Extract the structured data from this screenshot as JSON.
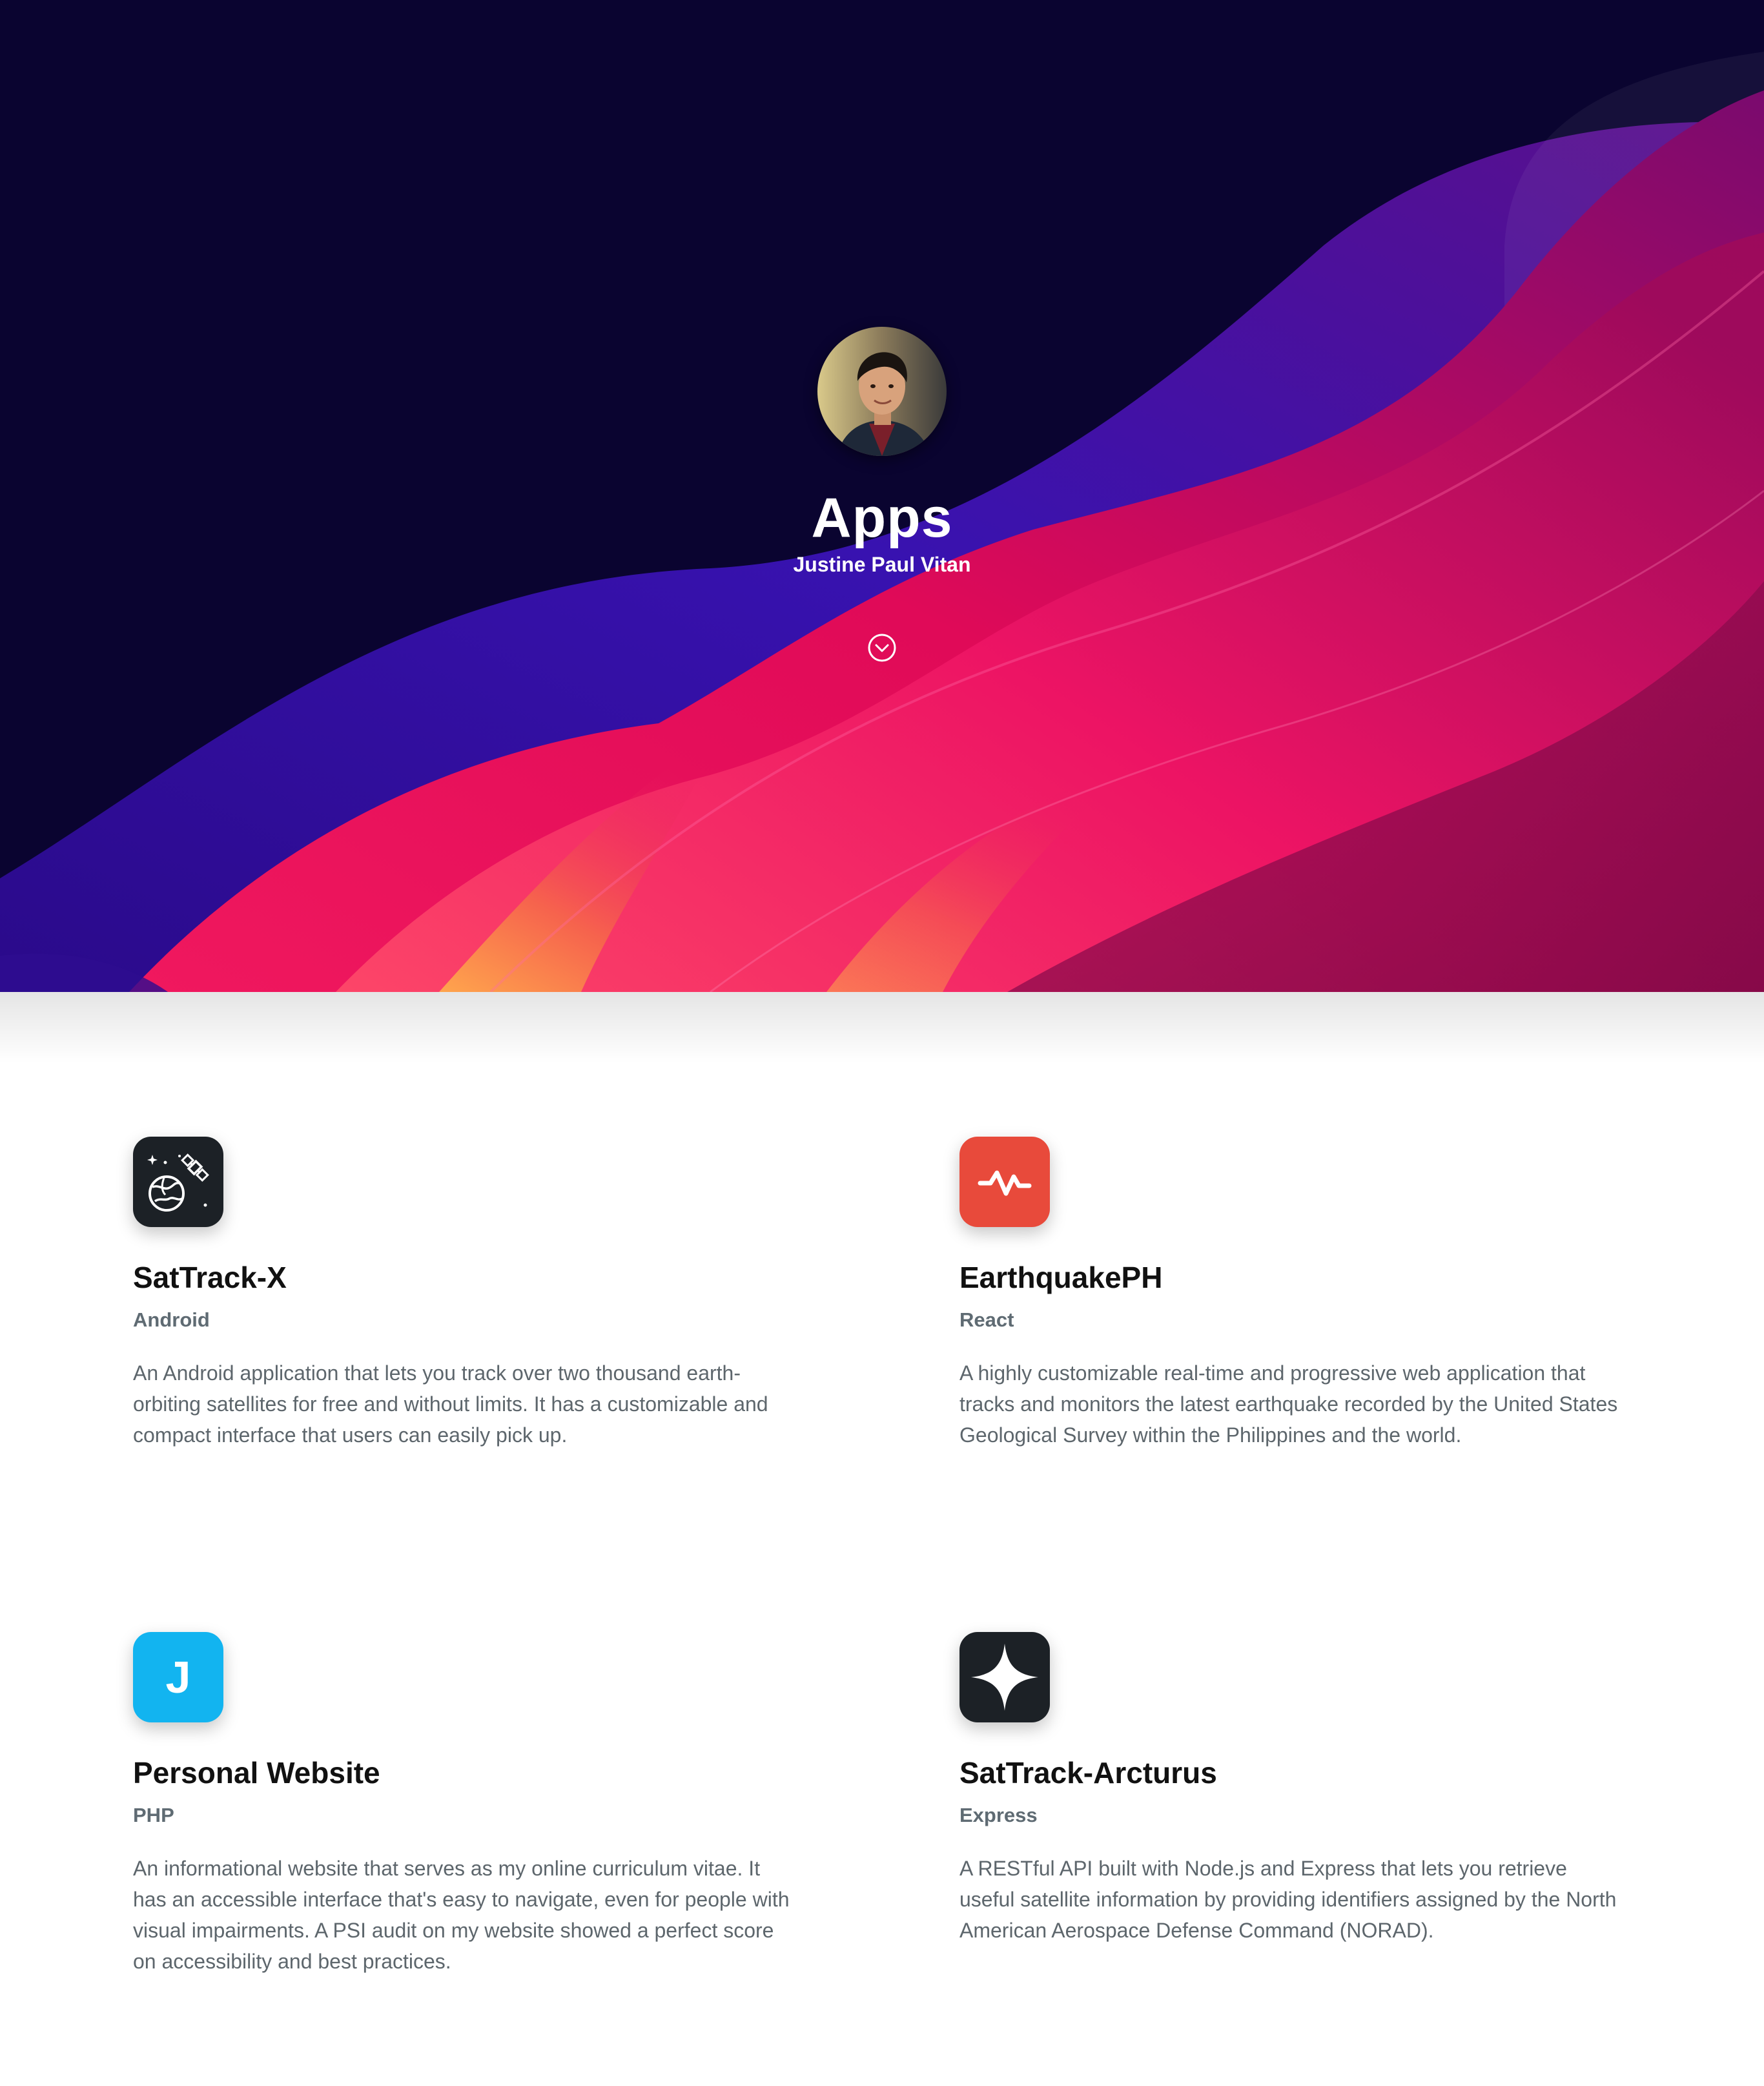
{
  "hero": {
    "title": "Apps",
    "subtitle": "Justine Paul Vitan",
    "scroll_icon": "chevron-down-circle-icon",
    "colors": {
      "background": "#0a0430",
      "magenta": "#e0105c",
      "purple": "#3a10a8",
      "orange": "#f46a3a"
    }
  },
  "apps": [
    {
      "name": "SatTrack-X",
      "tech": "Android",
      "description": "An Android application that lets you track over two thousand earth-orbiting satellites for free and without limits. It has a customizable and compact interface that users can easily pick up.",
      "icon": "earth-satellite-icon",
      "icon_color": "#1c2126"
    },
    {
      "name": "EarthquakePH",
      "tech": "React",
      "description": "A highly customizable real-time and progressive web application that tracks and monitors the latest earthquake recorded by the United States Geological Survey within the Philippines and the world.",
      "icon": "seismograph-icon",
      "icon_color": "#e84a3b"
    },
    {
      "name": "Personal Website",
      "tech": "PHP",
      "description": "An informational website that serves as my online curriculum vitae. It has an accessible interface that's easy to navigate, even for people with visual impairments. A PSI audit on my website showed a perfect score on accessibility and best practices.",
      "icon": "letter-j-icon",
      "icon_letter": "J",
      "icon_color": "#12b4f0"
    },
    {
      "name": "SatTrack-Arcturus",
      "tech": "Express",
      "description": "A RESTful API built with Node.js and Express that lets you retrieve useful satellite information by providing identifiers assigned by the North American Aerospace Defense Command (NORAD).",
      "icon": "four-point-star-icon",
      "icon_color": "#1c2126"
    }
  ]
}
